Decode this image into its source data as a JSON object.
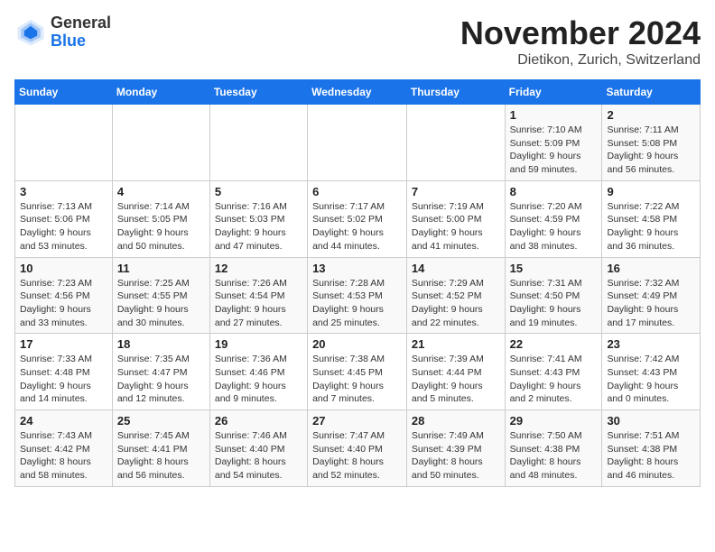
{
  "logo": {
    "general": "General",
    "blue": "Blue"
  },
  "title": "November 2024",
  "location": "Dietikon, Zurich, Switzerland",
  "weekdays": [
    "Sunday",
    "Monday",
    "Tuesday",
    "Wednesday",
    "Thursday",
    "Friday",
    "Saturday"
  ],
  "weeks": [
    [
      {
        "day": "",
        "info": ""
      },
      {
        "day": "",
        "info": ""
      },
      {
        "day": "",
        "info": ""
      },
      {
        "day": "",
        "info": ""
      },
      {
        "day": "",
        "info": ""
      },
      {
        "day": "1",
        "info": "Sunrise: 7:10 AM\nSunset: 5:09 PM\nDaylight: 9 hours and 59 minutes."
      },
      {
        "day": "2",
        "info": "Sunrise: 7:11 AM\nSunset: 5:08 PM\nDaylight: 9 hours and 56 minutes."
      }
    ],
    [
      {
        "day": "3",
        "info": "Sunrise: 7:13 AM\nSunset: 5:06 PM\nDaylight: 9 hours and 53 minutes."
      },
      {
        "day": "4",
        "info": "Sunrise: 7:14 AM\nSunset: 5:05 PM\nDaylight: 9 hours and 50 minutes."
      },
      {
        "day": "5",
        "info": "Sunrise: 7:16 AM\nSunset: 5:03 PM\nDaylight: 9 hours and 47 minutes."
      },
      {
        "day": "6",
        "info": "Sunrise: 7:17 AM\nSunset: 5:02 PM\nDaylight: 9 hours and 44 minutes."
      },
      {
        "day": "7",
        "info": "Sunrise: 7:19 AM\nSunset: 5:00 PM\nDaylight: 9 hours and 41 minutes."
      },
      {
        "day": "8",
        "info": "Sunrise: 7:20 AM\nSunset: 4:59 PM\nDaylight: 9 hours and 38 minutes."
      },
      {
        "day": "9",
        "info": "Sunrise: 7:22 AM\nSunset: 4:58 PM\nDaylight: 9 hours and 36 minutes."
      }
    ],
    [
      {
        "day": "10",
        "info": "Sunrise: 7:23 AM\nSunset: 4:56 PM\nDaylight: 9 hours and 33 minutes."
      },
      {
        "day": "11",
        "info": "Sunrise: 7:25 AM\nSunset: 4:55 PM\nDaylight: 9 hours and 30 minutes."
      },
      {
        "day": "12",
        "info": "Sunrise: 7:26 AM\nSunset: 4:54 PM\nDaylight: 9 hours and 27 minutes."
      },
      {
        "day": "13",
        "info": "Sunrise: 7:28 AM\nSunset: 4:53 PM\nDaylight: 9 hours and 25 minutes."
      },
      {
        "day": "14",
        "info": "Sunrise: 7:29 AM\nSunset: 4:52 PM\nDaylight: 9 hours and 22 minutes."
      },
      {
        "day": "15",
        "info": "Sunrise: 7:31 AM\nSunset: 4:50 PM\nDaylight: 9 hours and 19 minutes."
      },
      {
        "day": "16",
        "info": "Sunrise: 7:32 AM\nSunset: 4:49 PM\nDaylight: 9 hours and 17 minutes."
      }
    ],
    [
      {
        "day": "17",
        "info": "Sunrise: 7:33 AM\nSunset: 4:48 PM\nDaylight: 9 hours and 14 minutes."
      },
      {
        "day": "18",
        "info": "Sunrise: 7:35 AM\nSunset: 4:47 PM\nDaylight: 9 hours and 12 minutes."
      },
      {
        "day": "19",
        "info": "Sunrise: 7:36 AM\nSunset: 4:46 PM\nDaylight: 9 hours and 9 minutes."
      },
      {
        "day": "20",
        "info": "Sunrise: 7:38 AM\nSunset: 4:45 PM\nDaylight: 9 hours and 7 minutes."
      },
      {
        "day": "21",
        "info": "Sunrise: 7:39 AM\nSunset: 4:44 PM\nDaylight: 9 hours and 5 minutes."
      },
      {
        "day": "22",
        "info": "Sunrise: 7:41 AM\nSunset: 4:43 PM\nDaylight: 9 hours and 2 minutes."
      },
      {
        "day": "23",
        "info": "Sunrise: 7:42 AM\nSunset: 4:43 PM\nDaylight: 9 hours and 0 minutes."
      }
    ],
    [
      {
        "day": "24",
        "info": "Sunrise: 7:43 AM\nSunset: 4:42 PM\nDaylight: 8 hours and 58 minutes."
      },
      {
        "day": "25",
        "info": "Sunrise: 7:45 AM\nSunset: 4:41 PM\nDaylight: 8 hours and 56 minutes."
      },
      {
        "day": "26",
        "info": "Sunrise: 7:46 AM\nSunset: 4:40 PM\nDaylight: 8 hours and 54 minutes."
      },
      {
        "day": "27",
        "info": "Sunrise: 7:47 AM\nSunset: 4:40 PM\nDaylight: 8 hours and 52 minutes."
      },
      {
        "day": "28",
        "info": "Sunrise: 7:49 AM\nSunset: 4:39 PM\nDaylight: 8 hours and 50 minutes."
      },
      {
        "day": "29",
        "info": "Sunrise: 7:50 AM\nSunset: 4:38 PM\nDaylight: 8 hours and 48 minutes."
      },
      {
        "day": "30",
        "info": "Sunrise: 7:51 AM\nSunset: 4:38 PM\nDaylight: 8 hours and 46 minutes."
      }
    ]
  ]
}
